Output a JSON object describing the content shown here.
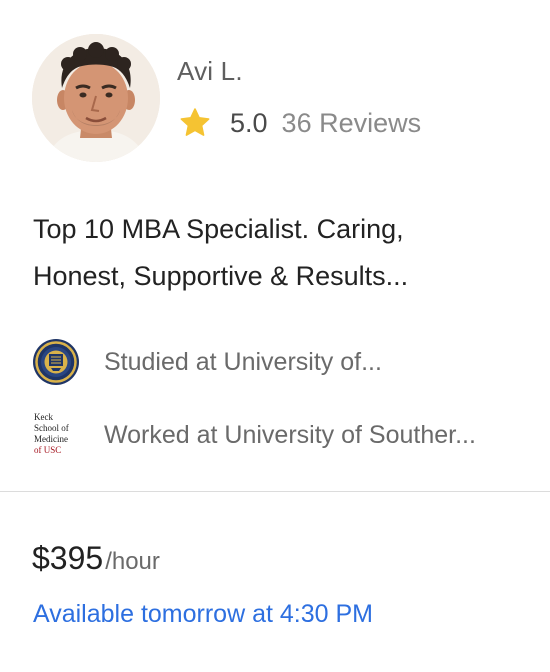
{
  "tutor": {
    "name": "Avi L.",
    "avatar_icon": "profile-photo",
    "rating": "5.0",
    "reviews": "36 Reviews",
    "star_color": "#F5C332",
    "headline_line1": "Top 10 MBA Specialist. Caring,",
    "headline_line2": "Honest, Supportive & Results..."
  },
  "credentials": [
    {
      "icon": "university-seal-icon",
      "text": "Studied at University of..."
    },
    {
      "icon": "keck-usc-logo",
      "text": "Worked at University of Souther...",
      "logo_lines": [
        "Keck",
        "School of",
        "Medicine",
        "of USC"
      ]
    }
  ],
  "pricing": {
    "price": "$395",
    "unit": "/hour",
    "availability": "Available tomorrow at 4:30 PM",
    "availability_color": "#2D6FE0"
  }
}
